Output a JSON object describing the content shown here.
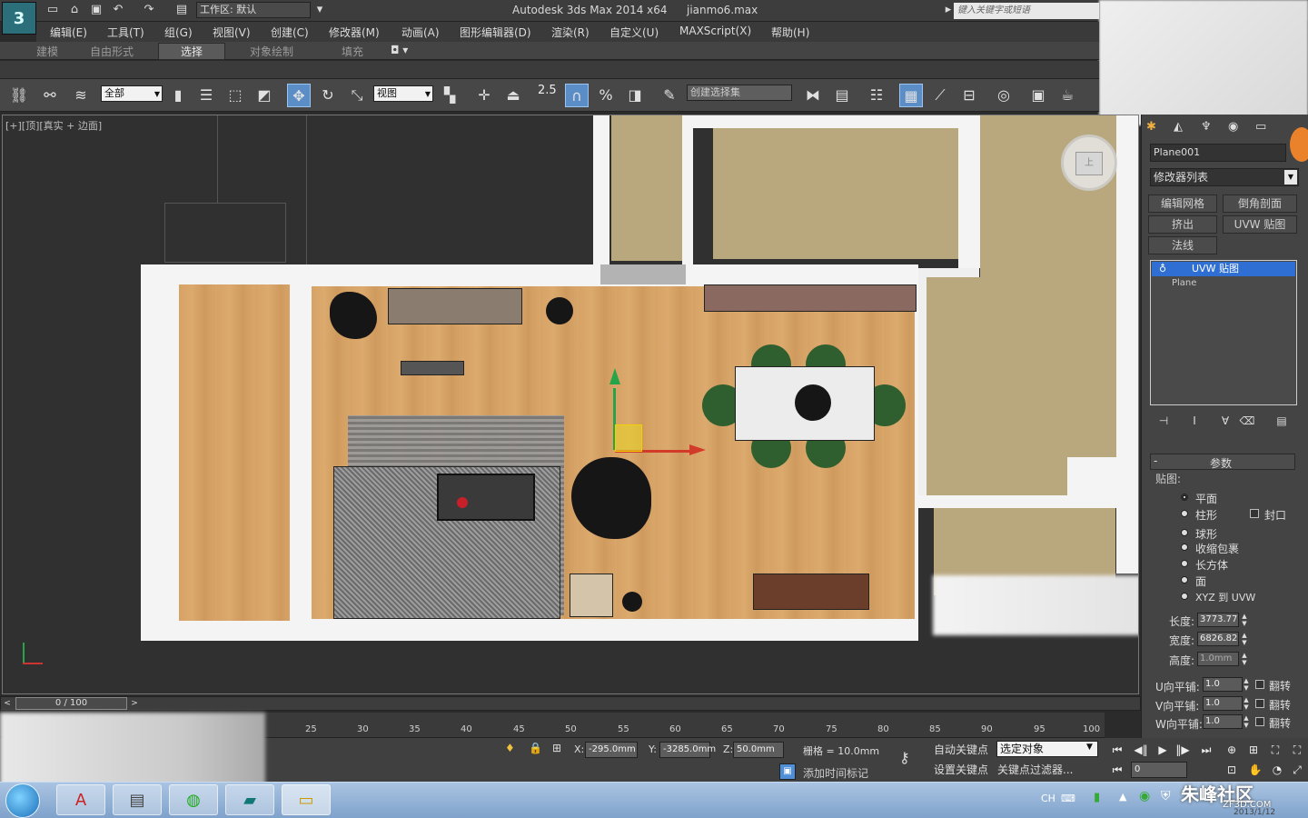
{
  "title_bar": {
    "workspace": "工作区: 默认",
    "app_title": "Autodesk 3ds Max  2014 x64",
    "file_name": "jianmo6.max",
    "search_placeholder": "键入关键字或短语"
  },
  "menu": [
    "编辑(E)",
    "工具(T)",
    "组(G)",
    "视图(V)",
    "创建(C)",
    "修改器(M)",
    "动画(A)",
    "图形编辑器(D)",
    "渲染(R)",
    "自定义(U)",
    "MAXScript(X)",
    "帮助(H)"
  ],
  "ribbon_tabs": [
    "建模",
    "自由形式",
    "选择",
    "对象绘制",
    "填充"
  ],
  "ribbon_active": "选择",
  "toolbar": {
    "filter_dropdown": "全部",
    "ref_coord_dropdown": "视图",
    "selection_set_field": "创建选择集",
    "snap_value": "2.5"
  },
  "viewport": {
    "label": "[+][顶][真实 + 边面]",
    "nav_cube_face": "上"
  },
  "command_panel": {
    "object_name": "Plane001",
    "modifier_list": "修改器列表",
    "modifier_buttons": [
      "编辑网格",
      "倒角剖面",
      "挤出",
      "UVW 贴图",
      "法线"
    ],
    "stack_selected": "UVW 贴图",
    "stack_base": "Plane",
    "params_title": "参数",
    "mapping_label": "贴图:",
    "mapping_options": [
      "平面",
      "柱形",
      "球形",
      "收缩包裹",
      "长方体",
      "面",
      "XYZ 到 UVW"
    ],
    "mapping_selected": "平面",
    "cap_label": "封口",
    "length_label": "长度:",
    "length_value": "3773.77",
    "width_label": "宽度:",
    "width_value": "6826.82",
    "height_label": "高度:",
    "height_value": "1.0mm",
    "u_tile_label": "U向平铺:",
    "v_tile_label": "V向平铺:",
    "w_tile_label": "W向平铺:",
    "u_tile": "1.0",
    "v_tile": "1.0",
    "w_tile": "1.0",
    "flip_label": "翻转"
  },
  "timeline": {
    "frame_display": "0 / 100",
    "ticks": [
      "25",
      "30",
      "35",
      "40",
      "45",
      "50",
      "55",
      "60",
      "65",
      "70",
      "75",
      "80",
      "85",
      "90",
      "95",
      "100"
    ]
  },
  "status": {
    "x_label": "X:",
    "x_value": "-295.0mm",
    "y_label": "Y:",
    "y_value": "-3285.0mm",
    "z_label": "Z:",
    "z_value": "50.0mm",
    "grid": "栅格 = 10.0mm",
    "auto_key": "自动关键点",
    "set_key": "设置关键点",
    "selection_dropdown": "选定对象",
    "key_filters": "关键点过滤器...",
    "add_time_tag": "添加时间标记",
    "frame_field": "0"
  },
  "taskbar": {
    "tray_lang": "CH",
    "watermark": "朱峰社区",
    "watermark_url": "ZF3D.COM",
    "date": "2013/1/12"
  }
}
